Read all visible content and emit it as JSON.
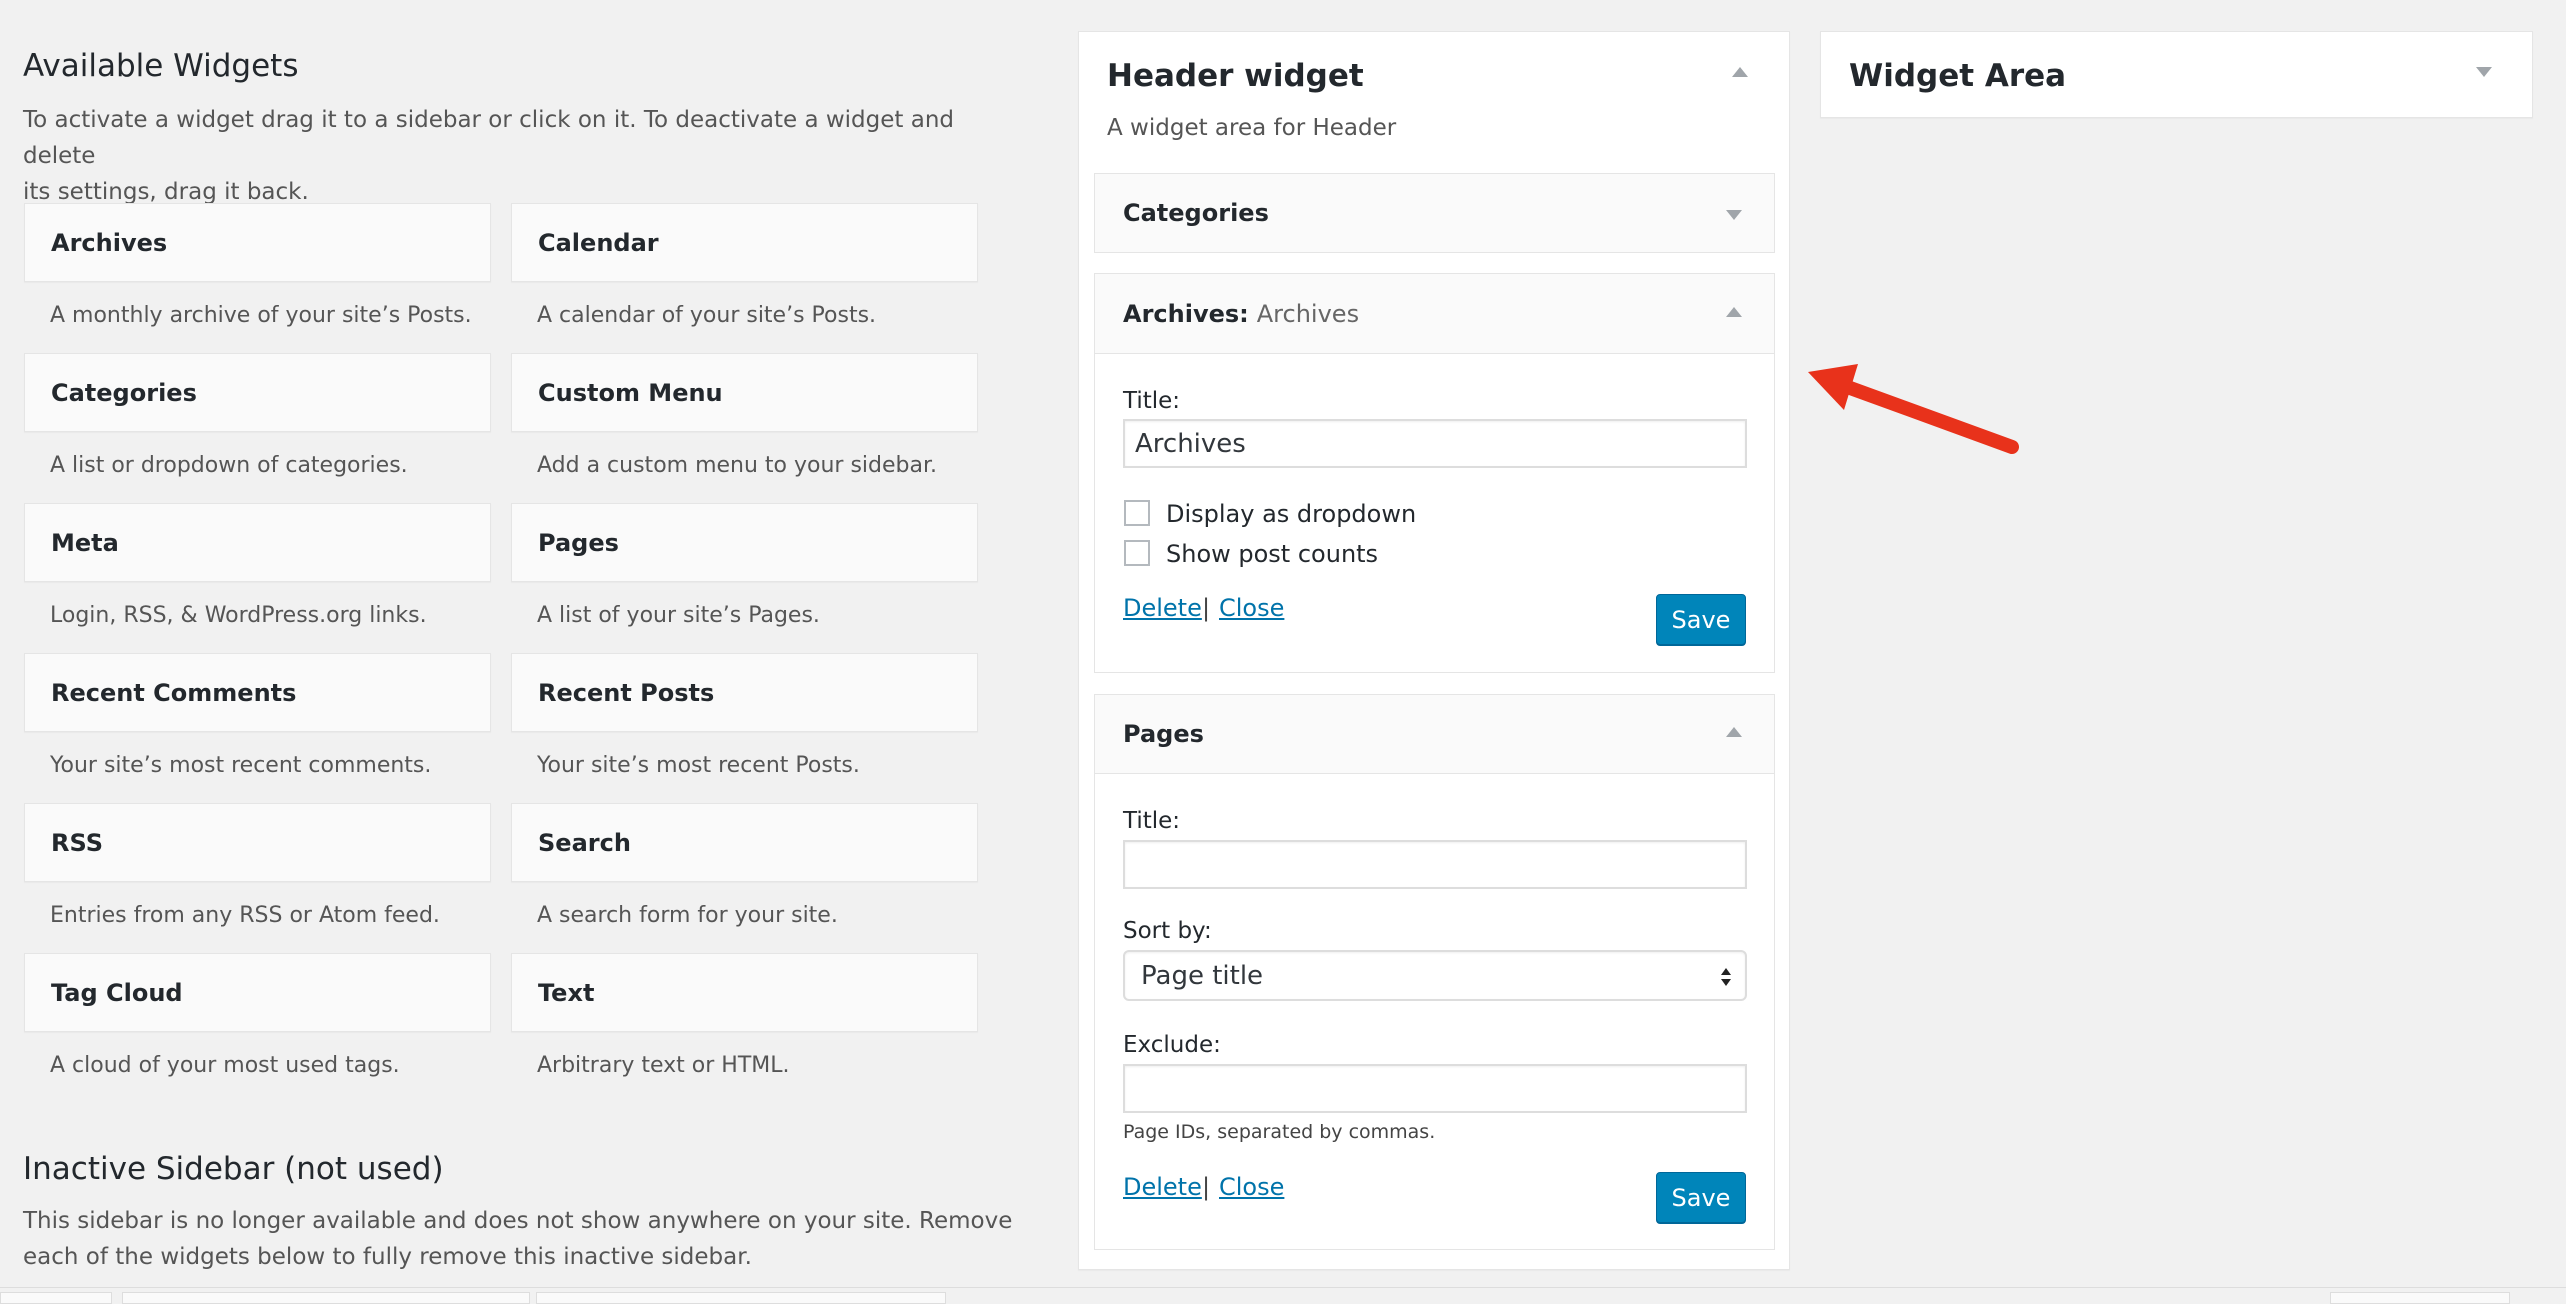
{
  "available": {
    "title": "Available Widgets",
    "description_line1": "To activate a widget drag it to a sidebar or click on it. To deactivate a widget and delete",
    "description_line2": "its settings, drag it back.",
    "widgets": [
      {
        "name": "Archives",
        "desc": "A monthly archive of your site’s Posts."
      },
      {
        "name": "Calendar",
        "desc": "A calendar of your site’s Posts."
      },
      {
        "name": "Categories",
        "desc": "A list or dropdown of categories."
      },
      {
        "name": "Custom Menu",
        "desc": "Add a custom menu to your sidebar."
      },
      {
        "name": "Meta",
        "desc": "Login, RSS, & WordPress.org links."
      },
      {
        "name": "Pages",
        "desc": "A list of your site’s Pages."
      },
      {
        "name": "Recent Comments",
        "desc": "Your site’s most recent comments."
      },
      {
        "name": "Recent Posts",
        "desc": "Your site’s most recent Posts."
      },
      {
        "name": "RSS",
        "desc": "Entries from any RSS or Atom feed."
      },
      {
        "name": "Search",
        "desc": "A search form for your site."
      },
      {
        "name": "Tag Cloud",
        "desc": "A cloud of your most used tags."
      },
      {
        "name": "Text",
        "desc": "Arbitrary text or HTML."
      }
    ]
  },
  "inactive": {
    "title": "Inactive Sidebar (not used)",
    "description_line1": "This sidebar is no longer available and does not show anywhere on your site. Remove",
    "description_line2": "each of the widgets below to fully remove this inactive sidebar."
  },
  "header_widget": {
    "title": "Header widget",
    "description": "A widget area for Header",
    "categories": {
      "title": "Categories"
    },
    "archives": {
      "title_prefix": "Archives:",
      "title_suffix": "Archives",
      "title_label": "Title:",
      "title_value": "Archives",
      "option_dropdown": "Display as dropdown",
      "option_counts": "Show post counts",
      "delete": "Delete",
      "separator": "|",
      "close": "Close",
      "save": "Save"
    },
    "pages": {
      "title": "Pages",
      "title_label": "Title:",
      "title_value": "",
      "sort_label": "Sort by:",
      "sort_value": "Page title",
      "exclude_label": "Exclude:",
      "exclude_value": "",
      "exclude_help": "Page IDs, separated by commas.",
      "delete": "Delete",
      "separator": "|",
      "close": "Close",
      "save": "Save"
    }
  },
  "widget_area": {
    "title": "Widget Area"
  },
  "icons": {
    "collapse": "caret-up-icon",
    "expand": "caret-down-icon",
    "annotation": "red-arrow"
  },
  "colors": {
    "accent": "#0085ba",
    "link": "#0073aa",
    "annotation": "#e8321b",
    "background": "#f1f1f1"
  }
}
